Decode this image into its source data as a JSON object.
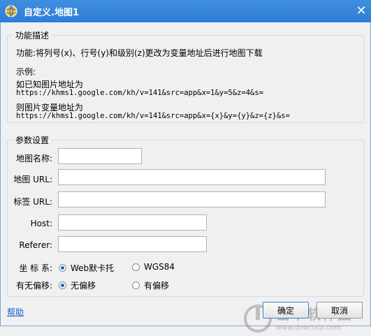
{
  "window": {
    "title": "自定义.地图1",
    "close_glyph": "✕"
  },
  "description": {
    "group_title": "功能描述",
    "function_text": "功能:将列号(x)、行号(y)和级别(z)更改为变量地址后进行地图下载",
    "example_label": "示例:",
    "known_label": "如已知图片地址为",
    "known_url": "https://khms1.google.com/kh/v=141&src=app&x=1&y=5&z=4&s=",
    "variable_label": "则图片变量地址为",
    "variable_url": "https://khms1.google.com/kh/v=141&src=app&x={x}&y={y}&z={z}&s="
  },
  "params": {
    "group_title": "参数设置",
    "map_name_label": "地图名称:",
    "map_name_value": "",
    "map_url_label": "地图 URL:",
    "map_url_value": "",
    "tag_url_label": "标签 URL:",
    "tag_url_value": "",
    "host_label": "Host:",
    "host_value": "",
    "referer_label": "Referer:",
    "referer_value": "",
    "coord_label": "坐 标 系:",
    "coord_options": [
      "Web默卡托",
      "WGS84"
    ],
    "coord_selected": "Web默卡托",
    "offset_label": "有无偏移:",
    "offset_options": [
      "无偏移",
      "有偏移"
    ],
    "offset_selected": "无偏移"
  },
  "footer": {
    "help_label": "帮助",
    "ok_label": "确定",
    "cancel_label": "取消"
  },
  "watermark": {
    "brand": "当下软件园",
    "url": "www.downxia.com"
  },
  "colors": {
    "titlebar": "#2f7bd6",
    "link": "#1a5fc9",
    "radio_dot": "#1d63c7"
  }
}
